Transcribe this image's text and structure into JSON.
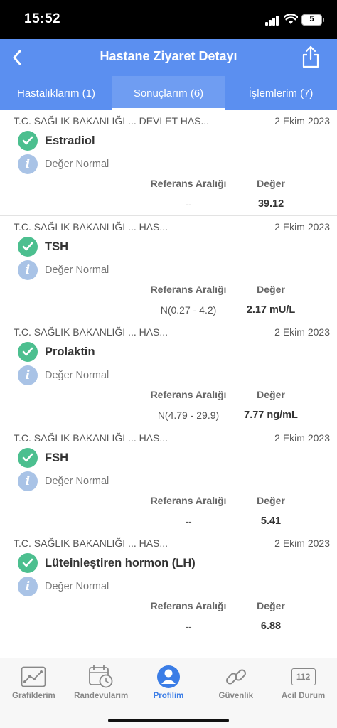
{
  "status_bar": {
    "time": "15:52",
    "battery": "5"
  },
  "header": {
    "title": "Hastane Ziyaret Detayı",
    "tabs": [
      {
        "label": "Hastalıklarım (1)"
      },
      {
        "label": "Sonuçlarım (6)"
      },
      {
        "label": "İşlemlerim (7)"
      }
    ]
  },
  "labels": {
    "ref_header": "Referans Aralığı",
    "value_header": "Değer"
  },
  "results": [
    {
      "source": "T.C. SAĞLIK BAKANLIĞI ... DEVLET HAS...",
      "date": "2 Ekim 2023",
      "name": "Estradiol",
      "status": "Değer Normal",
      "ref": "--",
      "value": "39.12"
    },
    {
      "source": "T.C. SAĞLIK BAKANLIĞI ... HAS...",
      "date": "2 Ekim 2023",
      "name": "TSH",
      "status": "Değer Normal",
      "ref": "N(0.27 - 4.2)",
      "value": "2.17 mU/L"
    },
    {
      "source": "T.C. SAĞLIK BAKANLIĞI ... HAS...",
      "date": "2 Ekim 2023",
      "name": "Prolaktin",
      "status": "Değer Normal",
      "ref": "N(4.79 - 29.9)",
      "value": "7.77 ng/mL"
    },
    {
      "source": "T.C. SAĞLIK BAKANLIĞI ... HAS...",
      "date": "2 Ekim 2023",
      "name": "FSH",
      "status": "Değer Normal",
      "ref": "--",
      "value": "5.41"
    },
    {
      "source": "T.C. SAĞLIK BAKANLIĞI ... HAS...",
      "date": "2 Ekim 2023",
      "name": "Lüteinleştiren hormon (LH)",
      "status": "Değer Normal",
      "ref": "--",
      "value": "6.88"
    }
  ],
  "bottom_nav": [
    {
      "label": "Grafiklerim",
      "icon": "chart-icon"
    },
    {
      "label": "Randevularım",
      "icon": "calendar-clock-icon"
    },
    {
      "label": "Profilim",
      "icon": "profile-icon"
    },
    {
      "label": "Güvenlik",
      "icon": "chain-link-icon"
    },
    {
      "label": "Acil Durum",
      "icon": "emergency-112-icon",
      "icon_text": "112"
    }
  ],
  "colors": {
    "header": "#5b8ff0",
    "check": "#4cbf8f",
    "info": "#a9c3e6",
    "nav_active": "#3b7de6"
  }
}
